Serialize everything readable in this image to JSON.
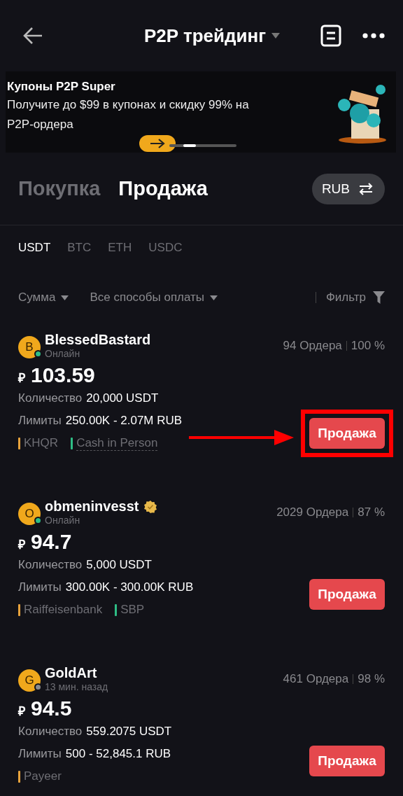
{
  "header": {
    "title": "P2P трейдинг"
  },
  "banner": {
    "title": "Купоны P2P Super",
    "text": "Получите до $99 в купонах и скидку 99% на P2P-ордера"
  },
  "side_tabs": [
    {
      "label": "Покупка",
      "selected": false
    },
    {
      "label": "Продажа",
      "selected": true
    }
  ],
  "currency_button": {
    "label": "RUB"
  },
  "coins": [
    {
      "label": "USDT",
      "selected": true
    },
    {
      "label": "BTC",
      "selected": false
    },
    {
      "label": "ETH",
      "selected": false
    },
    {
      "label": "USDC",
      "selected": false
    }
  ],
  "filters": {
    "amount": "Сумма",
    "payment": "Все способы оплаты",
    "filter": "Фильтр"
  },
  "offers": [
    {
      "initial": "B",
      "name": "BlessedBastard",
      "online": true,
      "status": "Онлайн",
      "orders": "94 Ордера",
      "rate": "100 %",
      "currency": "₽",
      "price": "103.59",
      "quantity_label": "Количество",
      "quantity": "20,000 USDT",
      "limits_label": "Лимиты",
      "limits": "250.00K - 2.07M RUB",
      "methods": [
        {
          "label": "KHQR",
          "color": "#e8a33c",
          "underlined": false
        },
        {
          "label": "Cash in Person",
          "color": "#2ebd85",
          "underlined": true
        }
      ],
      "button": "Продажа",
      "highlighted": true
    },
    {
      "initial": "O",
      "name": "obmeninvesst",
      "verified": true,
      "online": true,
      "status": "Онлайн",
      "orders": "2029 Ордера",
      "rate": "87 %",
      "currency": "₽",
      "price": "94.7",
      "quantity_label": "Количество",
      "quantity": "5,000 USDT",
      "limits_label": "Лимиты",
      "limits": "300.00K - 300.00K RUB",
      "methods": [
        {
          "label": "Raiffeisenbank",
          "color": "#e8a33c",
          "underlined": false
        },
        {
          "label": "SBP",
          "color": "#2ebd85",
          "underlined": false
        }
      ],
      "button": "Продажа"
    },
    {
      "initial": "G",
      "name": "GoldArt",
      "online": false,
      "status": "13 мин. назад",
      "orders": "461 Ордера",
      "rate": "98 %",
      "currency": "₽",
      "price": "94.5",
      "quantity_label": "Количество",
      "quantity": "559.2075 USDT",
      "limits_label": "Лимиты",
      "limits": "500 - 52,845.1 RUB",
      "methods": [
        {
          "label": "Payeer",
          "color": "#e8a33c"
        }
      ],
      "button": "Продажа"
    }
  ]
}
